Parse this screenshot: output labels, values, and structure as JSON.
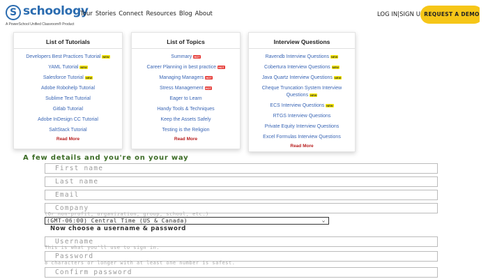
{
  "header": {
    "logo_mark": "S",
    "logo_word": "schoology",
    "logo_tagline": "A PowerSchool Unified Classroom® Product",
    "nav": [
      "Tour",
      "Stories",
      "Connect",
      "Resources",
      "Blog",
      "About"
    ],
    "login": "LOG IN",
    "signup": "SIGN UP",
    "demo_button": "REQUEST A DEMO"
  },
  "colors": {
    "brand": "#2b6cb0",
    "demo_button": "#f6c618",
    "link": "#3a66b5",
    "read_more": "#b71c1c",
    "form_heading": "#3b6b25"
  },
  "panels": [
    {
      "title": "List of Tutorials",
      "items": [
        {
          "text": "Developers Best Practices Tutorial",
          "badge": "NEW"
        },
        {
          "text": "YAML Tutorial",
          "badge": "NEW"
        },
        {
          "text": "Salesforce Tutorial",
          "badge": "NEW"
        },
        {
          "text": "Adobe Robohelp Tutorial",
          "badge": ""
        },
        {
          "text": "Sublime Text Tutorial",
          "badge": ""
        },
        {
          "text": "Gitlab Tutorial",
          "badge": ""
        },
        {
          "text": "Adobe InDesign CC Tutorial",
          "badge": ""
        },
        {
          "text": "SaltStack Tutorial",
          "badge": ""
        }
      ],
      "read_more": "Read More"
    },
    {
      "title": "List of Topics",
      "items": [
        {
          "text": "Summary",
          "badge": "HOT"
        },
        {
          "text": "Career Planning in best practice",
          "badge": "HOT"
        },
        {
          "text": "Managing Managers",
          "badge": "HOT"
        },
        {
          "text": "Stress Management",
          "badge": "HOT"
        },
        {
          "text": "Eager to Learn",
          "badge": ""
        },
        {
          "text": "Handy Tools & Techniques",
          "badge": ""
        },
        {
          "text": "Keep the Assets Safely",
          "badge": ""
        },
        {
          "text": "Testing is the Religion",
          "badge": ""
        }
      ],
      "read_more": "Read More"
    },
    {
      "title": "Interview Questions",
      "items": [
        {
          "text": "Ravendb Interview Questions",
          "badge": "NEW"
        },
        {
          "text": "Cobertura Interview Questions",
          "badge": "NEW"
        },
        {
          "text": "Java Quartz Interview Questions",
          "badge": "NEW"
        },
        {
          "text": "Cheque Truncation System Interview Questions",
          "badge": "NEW"
        },
        {
          "text": "ECS Interview Questions",
          "badge": "NEW"
        },
        {
          "text": "RTGS Interview Questions",
          "badge": ""
        },
        {
          "text": "Private Equity Interview Questions",
          "badge": ""
        },
        {
          "text": "Excel Formulas Interview Questions",
          "badge": ""
        }
      ],
      "read_more": "Read More"
    }
  ],
  "form": {
    "heading": "A few details and you're on your way",
    "first_name": "First name",
    "last_name": "Last name",
    "email": "Email",
    "company": "Company",
    "company_hint": "(Or non-profit, organization, group, school, etc.)",
    "timezone": "(GMT-06:00) Central Time (US & Canada)",
    "credentials_heading": "Now choose a username & password",
    "username": "Username",
    "username_hint": "This is what you'll use to sign in.",
    "password": "Password",
    "password_hint": "8 characters or longer with at least one number is safest.",
    "confirm_password": "Confirm password"
  }
}
